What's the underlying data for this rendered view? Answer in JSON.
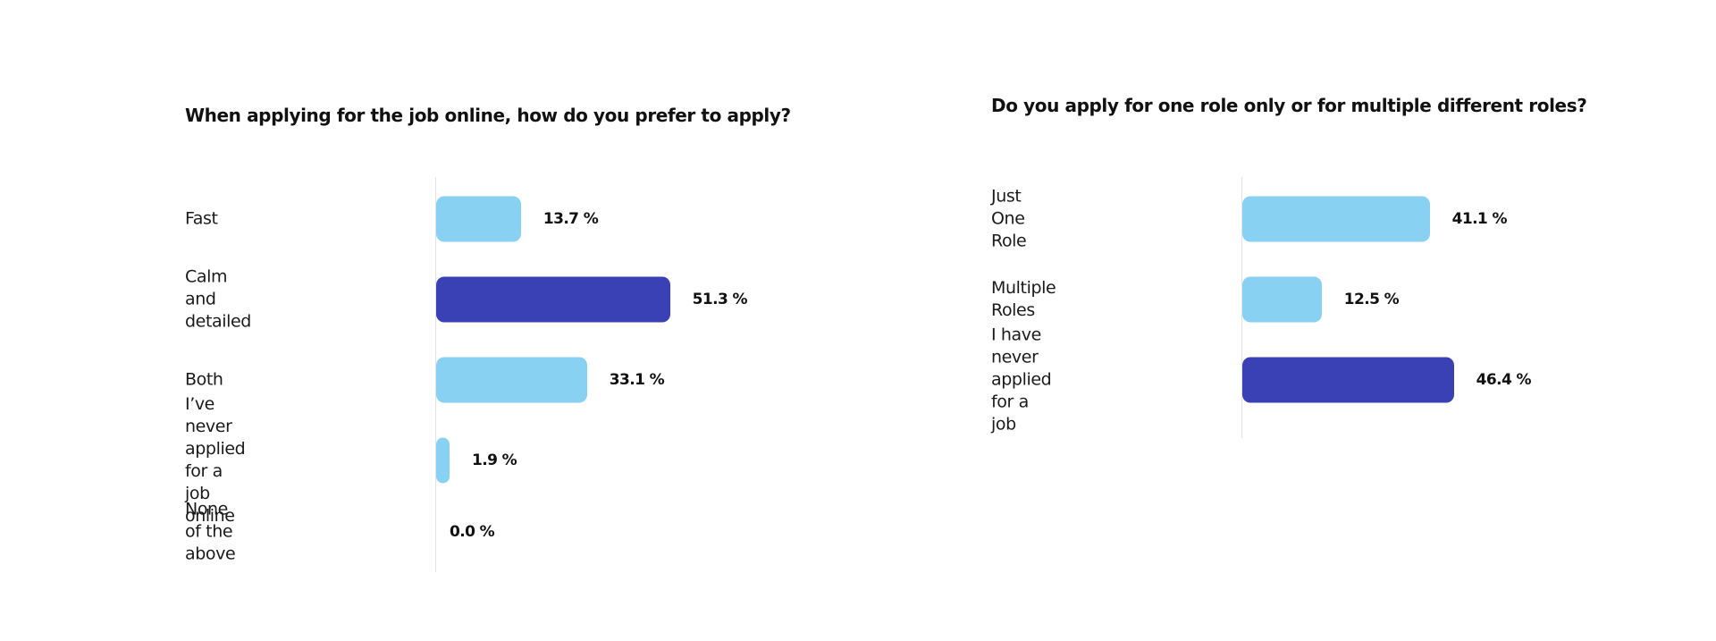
{
  "colors": {
    "light": "#89D1F2",
    "dark": "#3A41B4",
    "axis": "#e3e3e3"
  },
  "chart_data": [
    {
      "type": "bar",
      "orientation": "horizontal",
      "title": "When applying for the job online, how do you prefer to apply?",
      "categories": [
        "Fast",
        "Calm and detailed",
        "Both",
        "I’ve never applied\nfor a job online",
        "None of the above"
      ],
      "values": [
        13.7,
        51.3,
        33.1,
        1.9,
        0.0
      ],
      "value_labels": [
        "13.7 %",
        "51.3 %",
        "33.1 %",
        "1.9 %",
        "0.0 %"
      ],
      "highlight": [
        false,
        true,
        false,
        false,
        false
      ],
      "unit": "%",
      "xlabel": "",
      "ylabel": "",
      "grid": false,
      "legend": "none"
    },
    {
      "type": "bar",
      "orientation": "horizontal",
      "title": "Do you apply for one role only or for multiple different roles?",
      "categories": [
        "Just One Role",
        "Multiple Roles",
        "I have never applied\nfor a job"
      ],
      "values": [
        41.1,
        12.5,
        46.4
      ],
      "value_labels": [
        "41.1 %",
        "12.5 %",
        "46.4 %"
      ],
      "highlight": [
        false,
        false,
        true
      ],
      "unit": "%",
      "xlabel": "",
      "ylabel": "",
      "grid": false,
      "legend": "none"
    }
  ]
}
